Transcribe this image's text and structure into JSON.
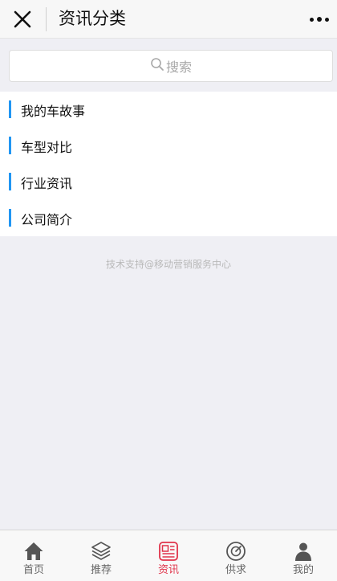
{
  "header": {
    "title": "资讯分类"
  },
  "search": {
    "placeholder": "搜索"
  },
  "categories": [
    {
      "label": "我的车故事"
    },
    {
      "label": "车型对比"
    },
    {
      "label": "行业资讯"
    },
    {
      "label": "公司简介"
    }
  ],
  "footer": {
    "note": "技术支持@移动营销服务中心"
  },
  "tabbar": {
    "items": [
      {
        "label": "首页",
        "icon": "home-icon"
      },
      {
        "label": "推荐",
        "icon": "layers-icon"
      },
      {
        "label": "资讯",
        "icon": "news-icon",
        "active": true
      },
      {
        "label": "供求",
        "icon": "compass-icon"
      },
      {
        "label": "我的",
        "icon": "user-icon"
      }
    ]
  },
  "colors": {
    "accent": "#e0334a",
    "category_bar": "#2196f3",
    "background": "#efeff4"
  }
}
